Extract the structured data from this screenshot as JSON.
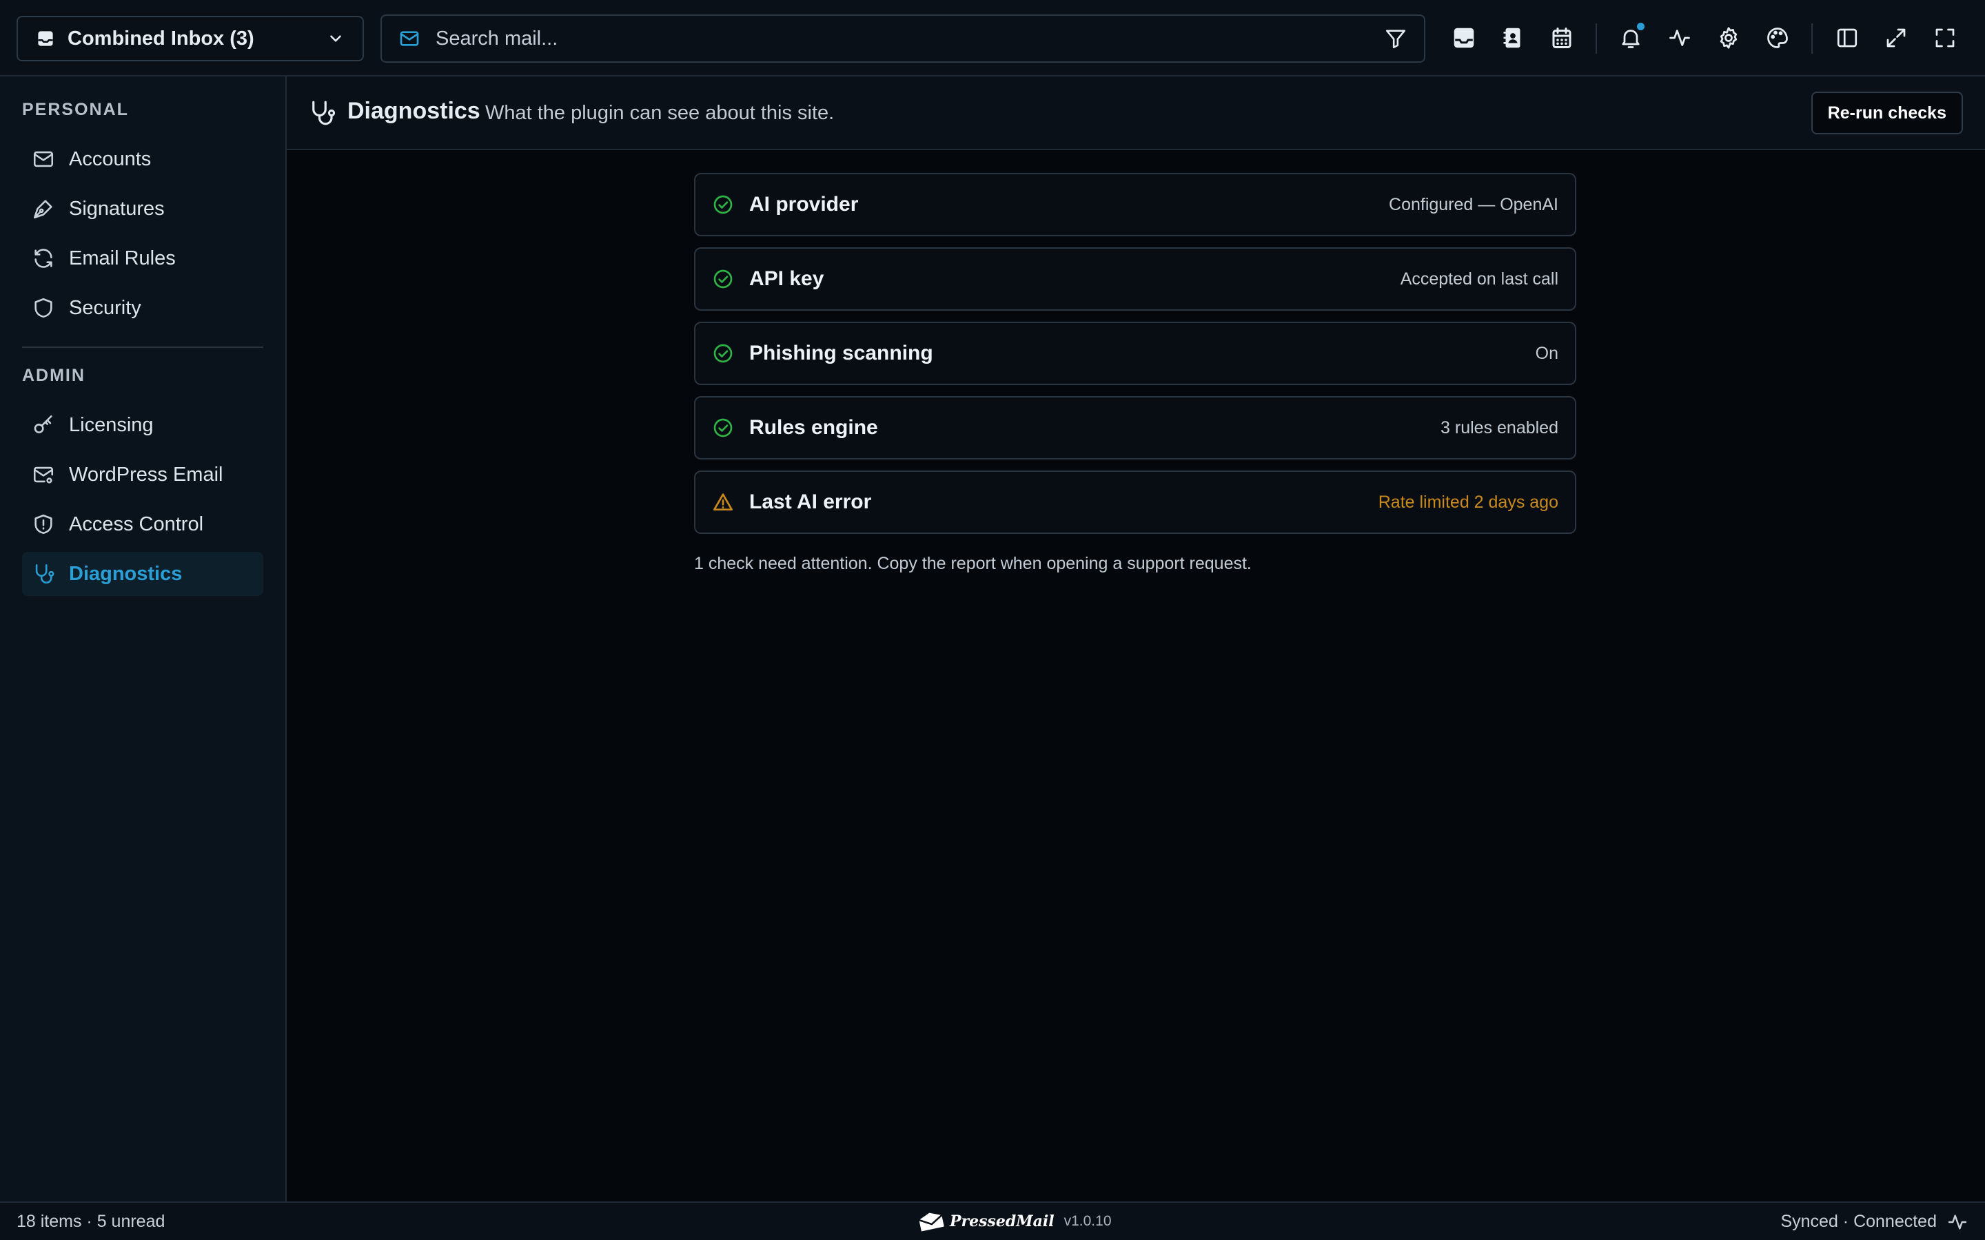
{
  "topbar": {
    "mailbox_label": "Combined Inbox (3)",
    "search_placeholder": "Search mail..."
  },
  "sidebar": {
    "personal_label": "PERSONAL",
    "personal_items": [
      {
        "label": "Accounts",
        "icon": "mail-icon"
      },
      {
        "label": "Signatures",
        "icon": "pen-icon"
      },
      {
        "label": "Email Rules",
        "icon": "refresh-icon"
      },
      {
        "label": "Security",
        "icon": "shield-icon"
      }
    ],
    "admin_label": "ADMIN",
    "admin_items": [
      {
        "label": "Licensing",
        "icon": "key-icon"
      },
      {
        "label": "WordPress Email",
        "icon": "mail-settings-icon"
      },
      {
        "label": "Access Control",
        "icon": "shield-alert-icon"
      },
      {
        "label": "Diagnostics",
        "icon": "stethoscope-icon",
        "active": true
      }
    ]
  },
  "main": {
    "title": "Diagnostics",
    "subtitle": "What the plugin can see about this site.",
    "rerun_label": "Re-run checks",
    "checks": [
      {
        "name": "AI provider",
        "value": "Configured — OpenAI",
        "status": "ok"
      },
      {
        "name": "API key",
        "value": "Accepted on last call",
        "status": "ok"
      },
      {
        "name": "Phishing scanning",
        "value": "On",
        "status": "ok"
      },
      {
        "name": "Rules engine",
        "value": "3 rules enabled",
        "status": "ok"
      },
      {
        "name": "Last AI error",
        "value": "Rate limited 2 days ago",
        "status": "warn"
      }
    ],
    "footnote": "1 check need attention. Copy the report when opening a support request."
  },
  "statusbar": {
    "left": "18 items · 5 unread",
    "brand": "PressedMail",
    "version": "v1.0.10",
    "right": "Synced · Connected"
  },
  "colors": {
    "accent": "#2a9fd6",
    "ok": "#2fb344",
    "warn": "#c98a1b",
    "background": "#04070c"
  }
}
